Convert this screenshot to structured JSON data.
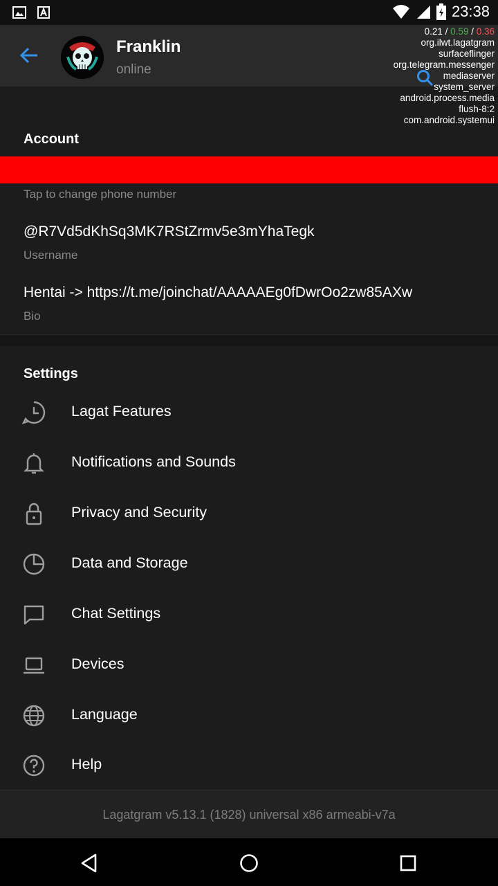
{
  "status_bar": {
    "time": "23:38",
    "icons": [
      "gallery-icon",
      "a-icon",
      "wifi-icon",
      "signal-icon",
      "battery-icon"
    ]
  },
  "header": {
    "name": "Franklin",
    "status": "online"
  },
  "overlay": {
    "load_a": "0.21",
    "load_b": "0.59",
    "load_c": "0.36",
    "processes": [
      "org.ilwt.lagatgram",
      "surfaceflinger",
      "org.telegram.messenger",
      "mediaserver",
      "system_server",
      "android.process.media",
      "flush-8:2",
      "com.android.systemui"
    ]
  },
  "account": {
    "title": "Account",
    "phone_hint": "Tap to change phone number",
    "username": "@R7Vd5dKhSq3MK7RStZrmv5e3mYhaTegk",
    "username_label": "Username",
    "bio": "Hentai -> https://t.me/joinchat/AAAAAEg0fDwrOo2zw85AXw",
    "bio_label": "Bio"
  },
  "settings": {
    "title": "Settings",
    "items": [
      {
        "label": "Lagat Features",
        "icon": "clock-bubble-icon"
      },
      {
        "label": "Notifications and Sounds",
        "icon": "bell-icon"
      },
      {
        "label": "Privacy and Security",
        "icon": "lock-icon"
      },
      {
        "label": "Data and Storage",
        "icon": "pie-chart-icon"
      },
      {
        "label": "Chat Settings",
        "icon": "chat-bubble-icon"
      },
      {
        "label": "Devices",
        "icon": "laptop-icon"
      },
      {
        "label": "Language",
        "icon": "globe-icon"
      },
      {
        "label": "Help",
        "icon": "help-icon"
      }
    ]
  },
  "footer": {
    "version": "Lagatgram v5.13.1 (1828) universal x86 armeabi-v7a"
  },
  "colors": {
    "accent": "#3390ec",
    "background": "#1c1c1c",
    "header": "#2a2a2a",
    "redacted": "#ff0000"
  }
}
